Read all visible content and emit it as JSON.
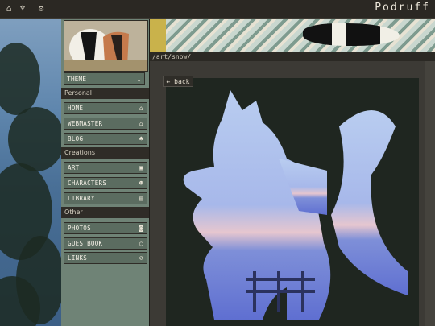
{
  "topbar": {
    "icons": [
      "home-icon",
      "tooth-icon",
      "gear-icon"
    ],
    "brand": "Podruff"
  },
  "sidebar": {
    "theme_label": "THEME",
    "sections": [
      {
        "title": "Personal",
        "items": [
          {
            "label": "HOME",
            "icon": "home-icon"
          },
          {
            "label": "WEBMASTER",
            "icon": "house-icon"
          },
          {
            "label": "BLOG",
            "icon": "leaf-icon"
          }
        ]
      },
      {
        "title": "Creations",
        "items": [
          {
            "label": "ART",
            "icon": "image-icon"
          },
          {
            "label": "CHARACTERS",
            "icon": "people-icon"
          },
          {
            "label": "LIBRARY",
            "icon": "book-icon"
          }
        ]
      },
      {
        "title": "Other",
        "items": [
          {
            "label": "PHOTOS",
            "icon": "camera-icon"
          },
          {
            "label": "GUESTBOOK",
            "icon": "chat-icon"
          },
          {
            "label": "LINKS",
            "icon": "paperclip-icon"
          }
        ]
      }
    ]
  },
  "content": {
    "path": "/art/snow/",
    "back_label": "← back"
  }
}
